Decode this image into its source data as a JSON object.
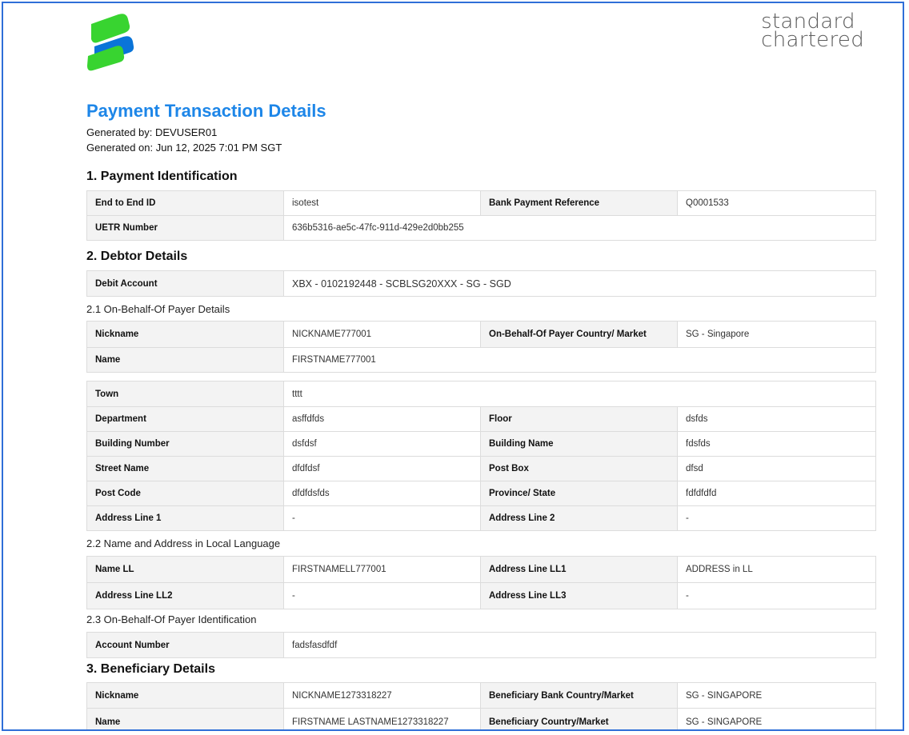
{
  "brand": {
    "line1": "standard",
    "line2": "chartered",
    "colors": {
      "green": "#38d430",
      "blue": "#0a74d8"
    }
  },
  "doc": {
    "title": "Payment Transaction Details",
    "generated_by": "Generated by: DEVUSER01",
    "generated_on": "Generated on: Jun 12, 2025 7:01 PM SGT",
    "accent": "#1d86e8"
  },
  "s1": {
    "title": "1. Payment Identification",
    "end_to_end_id_label": "End to End ID",
    "end_to_end_id": "isotest",
    "bank_payment_ref_label": "Bank Payment Reference",
    "bank_payment_ref": "Q0001533",
    "uetr_label": "UETR Number",
    "uetr": "636b5316-ae5c-47fc-911d-429e2d0bb255"
  },
  "s2": {
    "title": "2. Debtor Details",
    "debit_account_label": "Debit Account",
    "debit_account": "XBX - 0102192448 - SCBLSG20XXX - SG - SGD",
    "obo": {
      "title": "2.1 On-Behalf-Of Payer Details",
      "nickname_label": "Nickname",
      "nickname": "NICKNAME777001",
      "country_label": "On-Behalf-Of Payer Country/ Market",
      "country": "SG - Singapore",
      "name_label": "Name",
      "name": "FIRSTNAME777001"
    },
    "address": {
      "town_label": "Town",
      "town": "tttt",
      "department_label": "Department",
      "department": "asffdfds",
      "floor_label": "Floor",
      "floor": "dsfds",
      "building_number_label": "Building Number",
      "building_number": "dsfdsf",
      "building_name_label": "Building Name",
      "building_name": "fdsfds",
      "street_name_label": "Street Name",
      "street_name": "dfdfdsf",
      "post_box_label": "Post Box",
      "post_box": "dfsd",
      "post_code_label": "Post Code",
      "post_code": "dfdfdsfds",
      "province_label": "Province/ State",
      "province": "fdfdfdfd",
      "address_line1_label": "Address Line 1",
      "address_line1": "-",
      "address_line2_label": "Address Line 2",
      "address_line2": "-"
    },
    "local": {
      "title": "2.2 Name and Address in Local Language",
      "name_ll_label": "Name LL",
      "name_ll": "FIRSTNAMELL777001",
      "addr_ll1_label": "Address Line LL1",
      "addr_ll1": "ADDRESS in LL",
      "addr_ll2_label": "Address Line LL2",
      "addr_ll2": "-",
      "addr_ll3_label": "Address Line LL3",
      "addr_ll3": "-"
    },
    "ident": {
      "title": "2.3 On-Behalf-Of Payer Identification",
      "account_number_label": "Account Number",
      "account_number": "fadsfasdfdf"
    }
  },
  "s3": {
    "title": "3. Beneficiary Details",
    "nickname_label": "Nickname",
    "nickname": "NICKNAME1273318227",
    "bank_country_label": "Beneficiary Bank Country/Market",
    "bank_country": "SG - SINGAPORE",
    "name_label": "Name",
    "name": "FIRSTNAME LASTNAME1273318227",
    "country_label": "Beneficiary Country/Market",
    "country": "SG - SINGAPORE"
  }
}
